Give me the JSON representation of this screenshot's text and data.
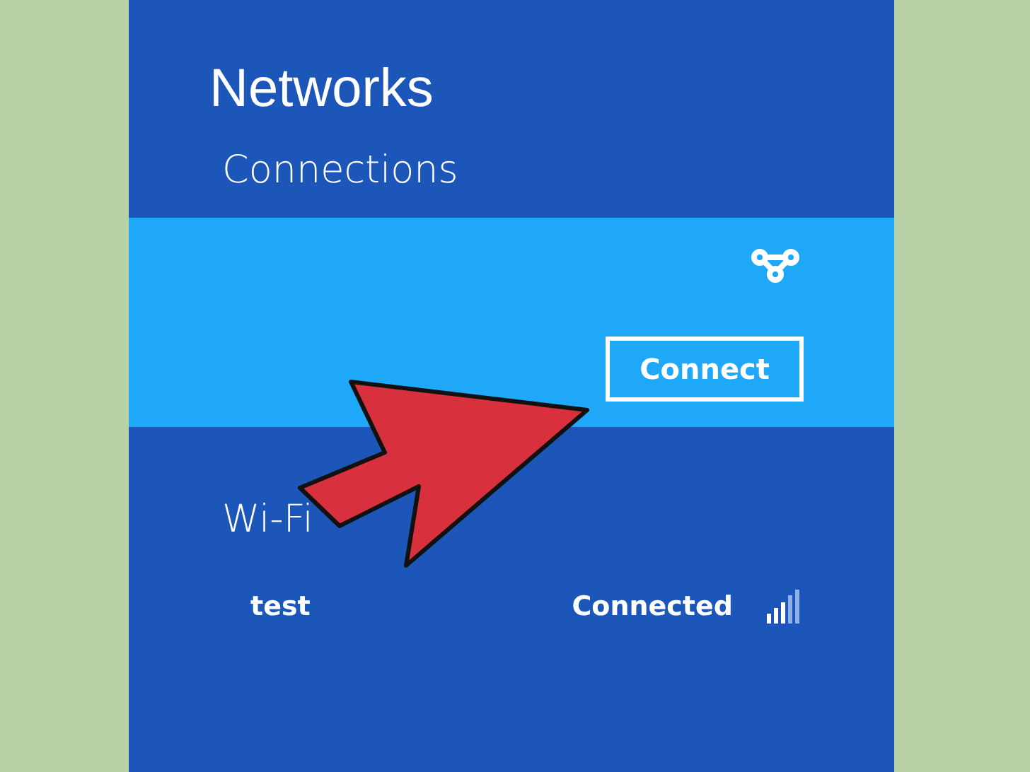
{
  "title": "Networks",
  "connections": {
    "heading": "Connections",
    "button": "Connect",
    "selected": true
  },
  "wifi": {
    "heading": "Wi-Fi",
    "networks": [
      {
        "name": "test",
        "status": "Connected"
      }
    ]
  }
}
